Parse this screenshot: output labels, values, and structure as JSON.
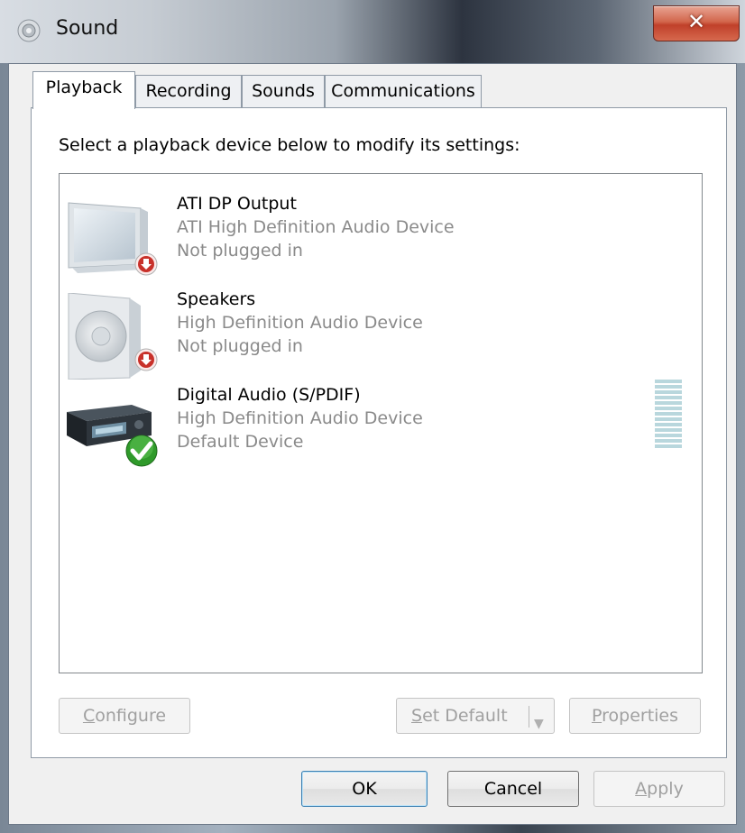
{
  "window": {
    "title": "Sound",
    "close_label": "✕",
    "icons": {
      "title": "speaker-window-icon",
      "close": "close-icon"
    }
  },
  "tabs": [
    {
      "label": "Playback",
      "active": true
    },
    {
      "label": "Recording",
      "active": false
    },
    {
      "label": "Sounds",
      "active": false
    },
    {
      "label": "Communications",
      "active": false
    }
  ],
  "panel": {
    "instruction": "Select a playback device below to modify its settings:"
  },
  "devices": [
    {
      "name": "ATI DP Output",
      "description": "ATI High Definition Audio Device",
      "status": "Not plugged in",
      "icon": "monitor-icon",
      "badge": "unplugged-badge-icon"
    },
    {
      "name": "Speakers",
      "description": "High Definition Audio Device",
      "status": "Not plugged in",
      "icon": "speaker-icon",
      "badge": "unplugged-badge-icon"
    },
    {
      "name": "Digital Audio (S/PDIF)",
      "description": "High Definition Audio Device",
      "status": "Default Device",
      "icon": "receiver-icon",
      "badge": "default-check-icon"
    }
  ],
  "buttons": {
    "configure": {
      "first": "C",
      "rest": "onfigure"
    },
    "set_default": {
      "first": "S",
      "rest": "et Default"
    },
    "properties": {
      "first": "P",
      "rest": "roperties"
    },
    "ok": "OK",
    "cancel": "Cancel",
    "apply": {
      "first": "A",
      "rest": "pply"
    }
  },
  "colors": {
    "accent_blue": "#3c7fb1",
    "unplugged_red": "#c8312a",
    "default_green": "#2f9a2a",
    "meter": "#b9d7dd"
  }
}
